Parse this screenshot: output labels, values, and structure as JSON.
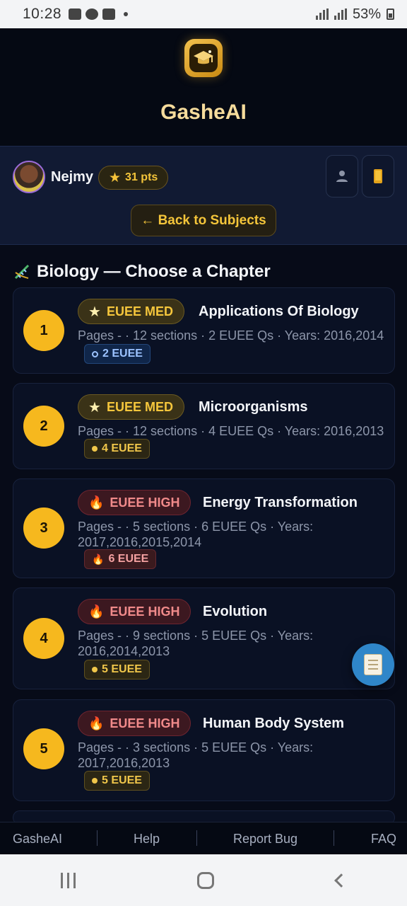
{
  "status": {
    "time": "10:28",
    "battery": "53%"
  },
  "app": {
    "title": "GasheAI"
  },
  "user": {
    "name": "Nejmy",
    "points": "31 pts",
    "back_label": "← Back to Subjects"
  },
  "section": {
    "title": "Biology — Choose a Chapter"
  },
  "chapters": [
    {
      "number": "1",
      "level": "EUEE MED",
      "title": "Applications Of Biology",
      "meta": "Pages - · 12 sections · 2 EUEE Qs · Years: 2016,2014",
      "pill": "2 EUEE"
    },
    {
      "number": "2",
      "level": "EUEE MED",
      "title": "Microorganisms",
      "meta": "Pages - · 12 sections · 4 EUEE Qs · Years: 2016,2013",
      "pill": "4 EUEE"
    },
    {
      "number": "3",
      "level": "EUEE HIGH",
      "title": "Energy Transformation",
      "meta": "Pages - · 5 sections · 6 EUEE Qs · Years: 2017,2016,2015,2014",
      "pill": "6 EUEE"
    },
    {
      "number": "4",
      "level": "EUEE HIGH",
      "title": "Evolution",
      "meta": "Pages - · 9 sections · 5 EUEE Qs · Years: 2016,2014,2013",
      "pill": "5 EUEE"
    },
    {
      "number": "5",
      "level": "EUEE HIGH",
      "title": "Human Body System",
      "meta": "Pages - · 3 sections · 5 EUEE Qs · Years: 2017,2016,2013",
      "pill": "5 EUEE"
    }
  ],
  "footer": {
    "links": [
      "GasheAI",
      "Help",
      "Report Bug",
      "FAQ"
    ]
  },
  "colors": {
    "accent": "#f6b81e",
    "background": "#070b18",
    "high": "#f08a8a",
    "med": "#f5c63c"
  }
}
